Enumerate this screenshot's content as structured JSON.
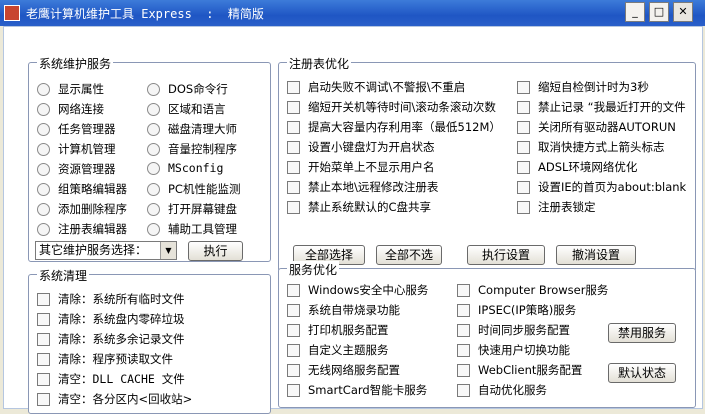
{
  "window": {
    "title": "老鹰计算机维护工具 Express  :  精简版",
    "minimize": "_",
    "maximize": "□",
    "close": "✕"
  },
  "system_services": {
    "title": "系统维护服务",
    "items": [
      "显示属性",
      "DOS命令行",
      "网络连接",
      "区域和语言",
      "任务管理器",
      "磁盘清理大师",
      "计算机管理",
      "音量控制程序",
      "资源管理器",
      "MSconfig",
      "组策略编辑器",
      "PC机性能监测",
      "添加删除程序",
      "打开屏幕键盘",
      "注册表编辑器",
      "辅助工具管理"
    ],
    "other_select": "其它维护服务选择：",
    "execute": "执行"
  },
  "system_cleanup": {
    "title": "系统清理",
    "items": [
      "清除：系统所有临时文件",
      "清除：系统盘内零碎垃圾",
      "清除：系统多余记录文件",
      "清除：程序预读取文件",
      "清空：DLL CACHE 文件",
      "清空：各分区内<回收站>"
    ]
  },
  "registry": {
    "title": "注册表优化",
    "left": [
      "启动失败不调试\\不警报\\不重启",
      "缩短开关机等待时间\\滚动条滚动次数",
      "提高大容量内存利用率（最低512M）",
      "设置小键盘灯为开启状态",
      "开始菜单上不显示用户名",
      "禁止本地\\远程修改注册表",
      "禁止系统默认的C盘共享"
    ],
    "right": [
      "缩短自检倒计时为3秒",
      "禁止记录 “我最近打开的文件",
      "关闭所有驱动器AUTORUN",
      "取消快捷方式上箭头标志",
      "ADSL环境网络优化",
      "设置IE的首页为about:blank",
      "注册表锁定"
    ],
    "buttons": [
      "全部选择",
      "全部不选",
      "执行设置",
      "撤消设置"
    ]
  },
  "services": {
    "title": "服务优化",
    "left": [
      "Windows安全中心服务",
      "系统自带烧录功能",
      "打印机服务配置",
      "自定义主题服务",
      "无线网络服务配置",
      "SmartCard智能卡服务"
    ],
    "right": [
      "Computer Browser服务",
      "IPSEC(IP策略)服务",
      "时间同步服务配置",
      "快速用户切换功能",
      "WebClient服务配置",
      "自动优化服务"
    ],
    "disable_button": "禁用服务",
    "default_button": "默认状态"
  }
}
